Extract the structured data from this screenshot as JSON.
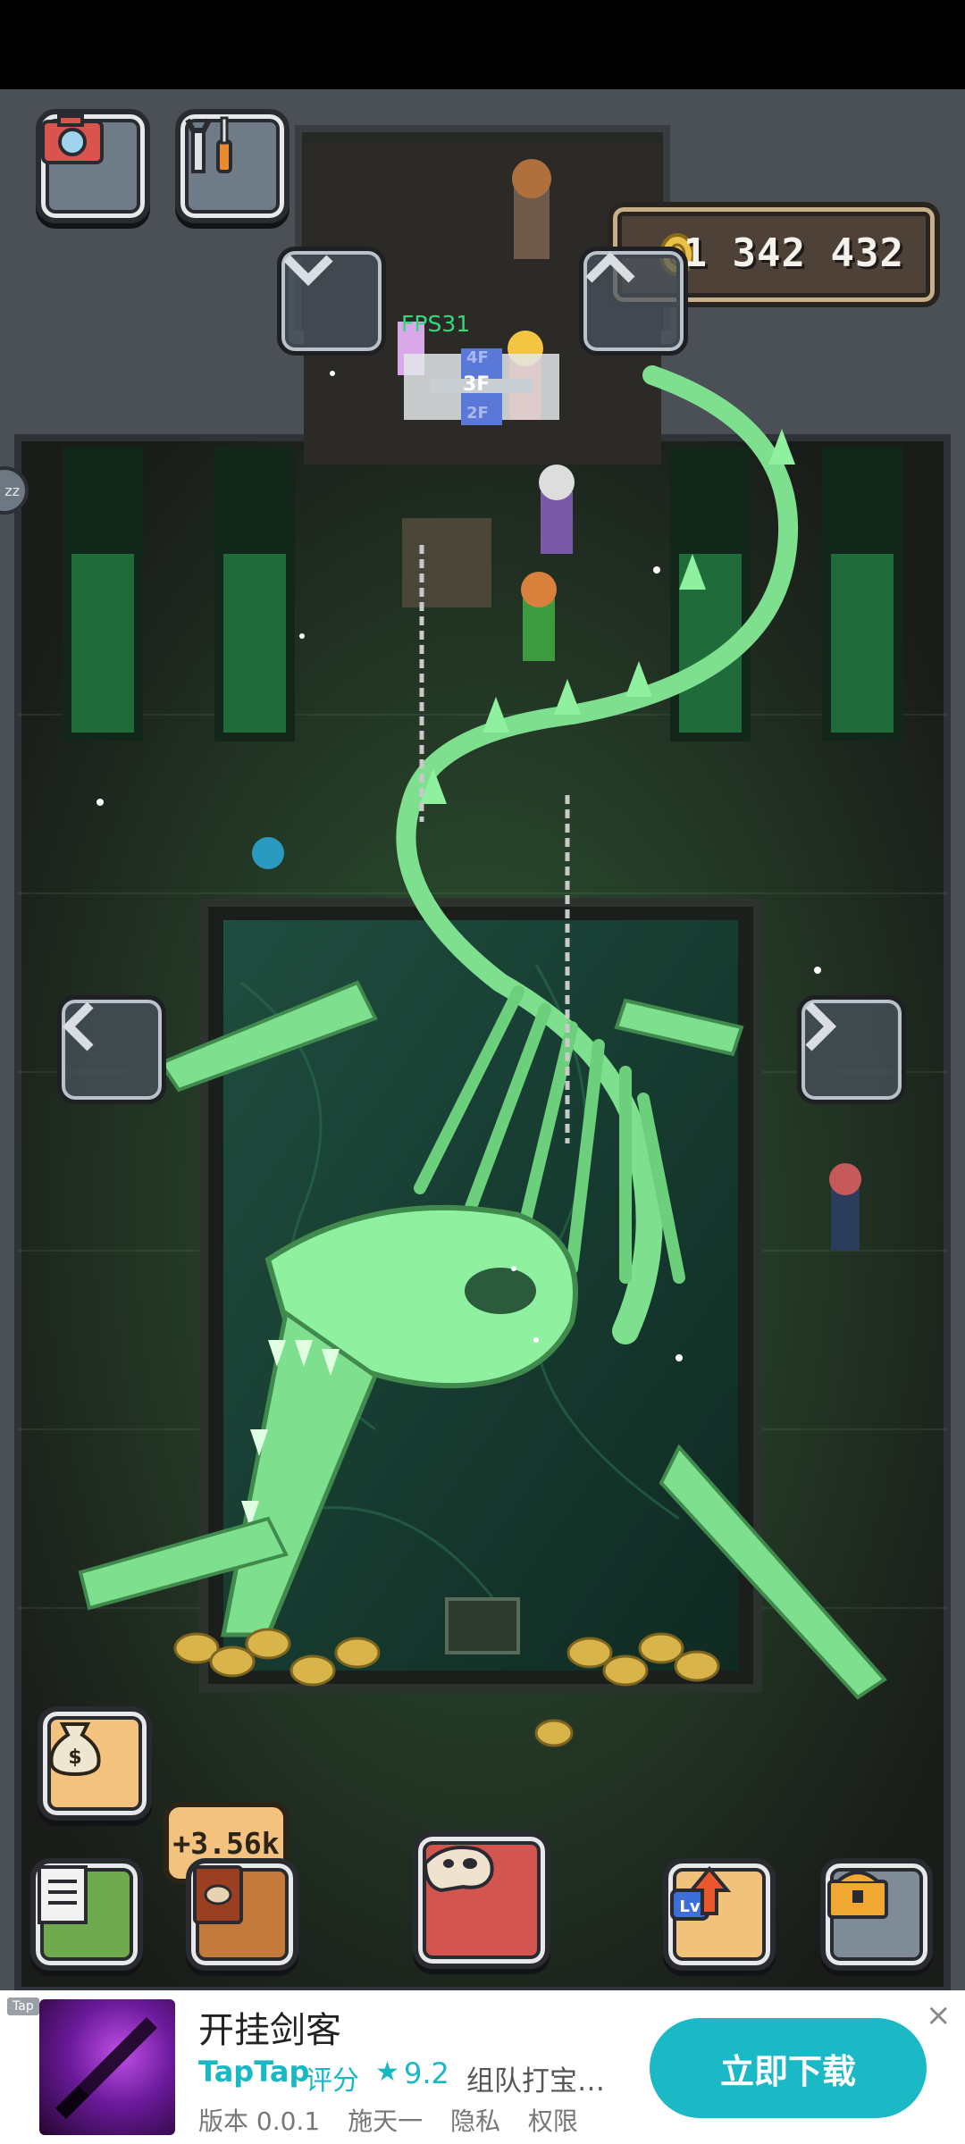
{
  "hud": {
    "coin_count": "1 342 432",
    "fps": "FPS31",
    "floors": [
      "4F",
      "3F",
      "2F"
    ],
    "current_floor": "3F",
    "income_rate": "+3.56k",
    "side_tab_label": "zz"
  },
  "icons": {
    "camera": "camera-icon",
    "tools": "wrench-screwdriver-icon",
    "coin": "gold-coin-icon",
    "money_bag": "money-bag-icon",
    "quests": "notepad-icon",
    "book": "fossil-book-icon",
    "fossil": "dinosaur-skull-icon",
    "level_up": "level-up-arrow-icon",
    "shop": "treasure-chest-icon"
  },
  "colors": {
    "accent_green": "#35d87a",
    "skeleton_green": "#7ee08f",
    "coin_gold": "#d9b44a",
    "ad_cyan": "#1bb8c6"
  },
  "ad": {
    "tag": "Tap",
    "title": "开挂剑客",
    "brand": "TapTap",
    "rating_label": "评分",
    "star": "★",
    "score": "9.2",
    "description": "组队打宝…",
    "version": "版本 0.0.1",
    "developer": "施天一",
    "privacy": "隐私",
    "permissions": "权限",
    "cta": "立即下载",
    "close": "×"
  }
}
